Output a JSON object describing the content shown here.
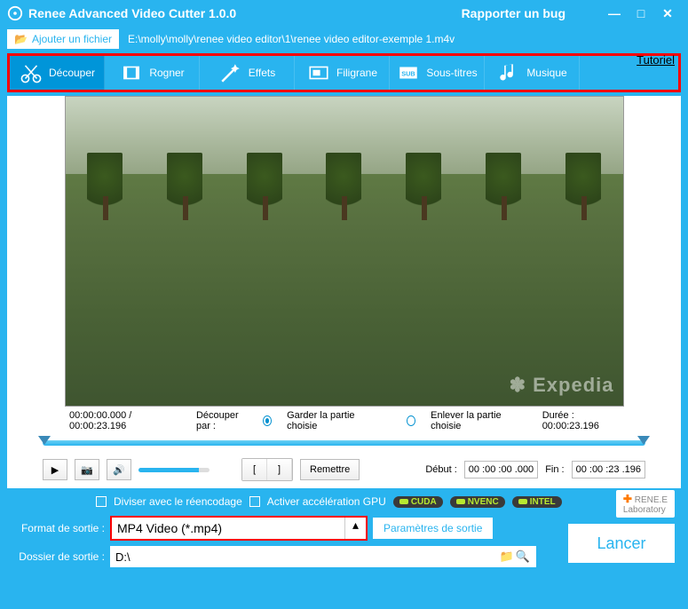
{
  "title": "Renee Advanced Video Cutter 1.0.0",
  "bug": "Rapporter un bug",
  "add_btn": "Ajouter un fichier",
  "filepath": "E:\\molly\\molly\\renee video editor\\1\\renee video editor-exemple 1.m4v",
  "tutorial": "Tutoriel",
  "tabs": {
    "cut": "Découper",
    "crop": "Rogner",
    "fx": "Effets",
    "water": "Filigrane",
    "sub": "Sous-titres",
    "music": "Musique"
  },
  "preview_logo": "✽ Expedia",
  "time_start": "00:00:00.000 / 00:00:23.196",
  "cut_by": "Découper par :",
  "keep": "Garder la partie choisie",
  "remove": "Enlever la partie choisie",
  "dur_label": "Durée : 00:00:23.196",
  "reset": "Remettre",
  "begin_label": "Début :",
  "begin_val": "00 :00 :00 .000",
  "end_label": "Fin :",
  "end_val": "00 :00 :23 .196",
  "divide": "Diviser avec le réencodage",
  "gpu": "Activer accélération GPU",
  "cuda": "CUDA",
  "nvenc": "NVENC",
  "intel": "INTEL",
  "brand": "RENE.E",
  "brand2": "Laboratory",
  "fmt_label": "Format de sortie :",
  "fmt_val": "MP4 Video (*.mp4)",
  "params": "Paramètres de sortie",
  "launch": "Lancer",
  "folder_label": "Dossier de sortie :",
  "folder_val": "D:\\"
}
